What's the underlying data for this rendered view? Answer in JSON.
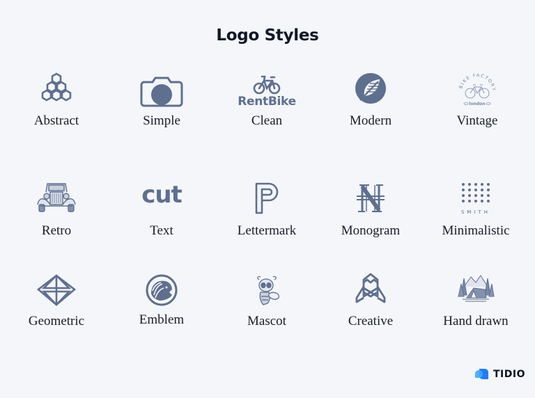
{
  "page": {
    "title": "Logo Styles"
  },
  "colors": {
    "background": "#f4f6f9",
    "icon": "#5f6f8f",
    "label": "#1a1d29",
    "title": "#111827",
    "brand_blue": "#1f7bff",
    "brand_light_blue": "#3da8ff"
  },
  "grid": [
    [
      {
        "label": "Abstract",
        "icon": "hexagon-cluster-icon"
      },
      {
        "label": "Simple",
        "icon": "camera-icon"
      },
      {
        "label": "Clean",
        "icon": "bicycle-icon",
        "logo_text": "RentBike"
      },
      {
        "label": "Modern",
        "icon": "leaf-circle-icon"
      },
      {
        "label": "Vintage",
        "icon": "vintage-bicycle-badge-icon",
        "logo_text": "BIKE FACTORY",
        "logo_subtext": "london"
      }
    ],
    [
      {
        "label": "Retro",
        "icon": "vintage-car-icon"
      },
      {
        "label": "Text",
        "icon": "wordmark-icon",
        "logo_text": "cut"
      },
      {
        "label": "Lettermark",
        "icon": "letter-p-icon"
      },
      {
        "label": "Monogram",
        "icon": "nh-monogram-icon"
      },
      {
        "label": "Minimalistic",
        "icon": "dot-grid-icon",
        "logo_text": "SMITH"
      }
    ],
    [
      {
        "label": "Geometric",
        "icon": "diamond-icon"
      },
      {
        "label": "Emblem",
        "icon": "lion-emblem-icon"
      },
      {
        "label": "Mascot",
        "icon": "bee-mascot-icon"
      },
      {
        "label": "Creative",
        "icon": "rocket-icon"
      },
      {
        "label": "Hand drawn",
        "icon": "mountain-tent-icon"
      }
    ]
  ],
  "brand": {
    "name": "TIDIO",
    "icon": "tidio-chat-bubbles-icon"
  }
}
